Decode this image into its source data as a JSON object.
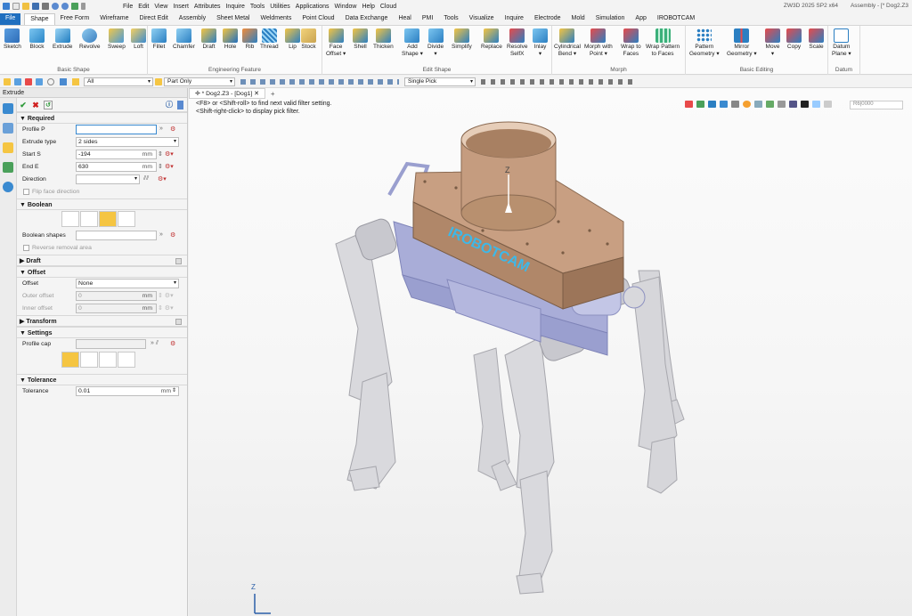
{
  "title_bar": {
    "app_version": "ZW3D 2025 SP2 x64",
    "document": "Assembly - [* Dog2.Z3"
  },
  "menu": [
    "File",
    "Edit",
    "View",
    "Insert",
    "Attributes",
    "Inquire",
    "Tools",
    "Utilities",
    "Applications",
    "Window",
    "Help",
    "Cloud"
  ],
  "tabs": [
    "File",
    "Shape",
    "Free Form",
    "Wireframe",
    "Direct Edit",
    "Assembly",
    "Sheet Metal",
    "Weldments",
    "Point Cloud",
    "Data Exchange",
    "Heal",
    "PMI",
    "Tools",
    "Visualize",
    "Inquire",
    "Electrode",
    "Mold",
    "Simulation",
    "App",
    "IROBOTCAM"
  ],
  "active_tab": "Shape",
  "ribbon": {
    "basic_shape": {
      "title": "Basic Shape",
      "tools": [
        "Sketch",
        "Block",
        "Extrude",
        "Revolve",
        "Sweep",
        "Loft"
      ]
    },
    "engineering_feature": {
      "title": "Engineering Feature",
      "tools": [
        "Fillet",
        "Chamfer",
        "Draft",
        "Hole",
        "Rib",
        "Thread",
        "Lip",
        "Stock"
      ]
    },
    "edit_shape": {
      "title": "Edit Shape",
      "tools": [
        [
          "Face",
          "Offset ▾"
        ],
        [
          "Shell",
          ""
        ],
        [
          "Thicken",
          ""
        ],
        [
          "Add",
          "Shape ▾"
        ],
        [
          "Divide",
          "▾"
        ],
        [
          "Simplify",
          ""
        ],
        [
          "Replace",
          ""
        ],
        [
          "Resolve",
          "SelfX"
        ],
        [
          "Inlay",
          "▾"
        ]
      ]
    },
    "morph": {
      "title": "Morph",
      "tools": [
        [
          "Cylindrical",
          "Bend ▾"
        ],
        [
          "Morph with",
          "Point ▾"
        ],
        [
          "Wrap to",
          "Faces"
        ],
        [
          "Wrap Pattern",
          "to Faces"
        ]
      ]
    },
    "basic_editing": {
      "title": "Basic Editing",
      "tools": [
        [
          "Pattern",
          "Geometry ▾"
        ],
        [
          "Mirror",
          "Geometry ▾"
        ],
        [
          "Move",
          "▾"
        ],
        [
          "Copy",
          ""
        ],
        [
          "Scale",
          ""
        ]
      ]
    },
    "datum": {
      "title": "Datum",
      "tools": [
        [
          "Datum",
          "Plane ▾"
        ]
      ]
    }
  },
  "toolbar": {
    "filter_all": "All",
    "part_only": "Part Only",
    "pick_mode": "Single Pick"
  },
  "panel": {
    "title": "Extrude",
    "sections": {
      "required": "Required",
      "boolean": "Boolean",
      "draft": "Draft",
      "offset": "Offset",
      "transform": "Transform",
      "settings": "Settings",
      "tolerance": "Tolerance"
    },
    "profile_label": "Profile P",
    "profile_value": "",
    "extrude_type_label": "Extrude type",
    "extrude_type_value": "2 sides",
    "start_label": "Start S",
    "start_value": "-194",
    "end_label": "End E",
    "end_value": "630",
    "unit": "mm",
    "direction_label": "Direction",
    "flip_label": "Flip face direction",
    "boolean_shapes_label": "Boolean shapes",
    "reverse_removal_label": "Reverse removal area",
    "offset_label": "Offset",
    "offset_value": "None",
    "outer_offset_label": "Outer offset",
    "outer_offset_value": "0",
    "inner_offset_label": "Inner offset",
    "inner_offset_value": "0",
    "profile_cap_label": "Profile cap",
    "tolerance_label": "Tolerance",
    "tolerance_value": "0.01"
  },
  "viewport": {
    "tab_label": "* Dog2.Z3 - [Dog1]",
    "hint_line1": "<F8> or <Shift-roll> to find next valid filter setting.",
    "hint_line2": "<Shift-right-click> to display pick filter.",
    "search_text": "R6|0000",
    "model_logo": "IROBOTCAM",
    "axis_z": "Z"
  },
  "colors": {
    "file_tab": "#1f6fbf",
    "accent": "#f5c542",
    "model_body": "#a9add8",
    "model_leg": "#d4d4d8",
    "model_top": "#c89f82",
    "logo": "#3db8e8"
  }
}
